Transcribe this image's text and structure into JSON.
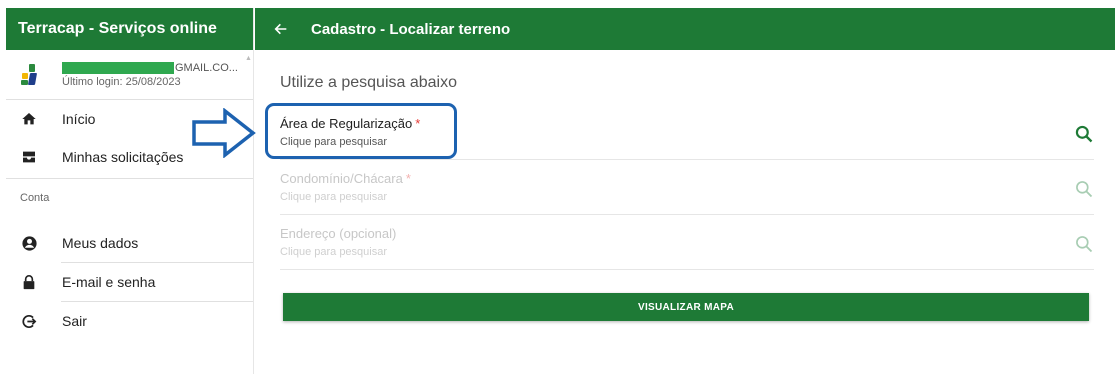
{
  "sidebar": {
    "title": "Terracap - Serviços online",
    "profile": {
      "email_suffix": "GMAIL.CO...",
      "last_login": "Último login: 25/08/2023"
    },
    "items": [
      {
        "label": "Início",
        "icon": "home-icon"
      },
      {
        "label": "Minhas solicitações",
        "icon": "inbox-icon"
      }
    ],
    "section_label": "Conta",
    "account_items": [
      {
        "label": "Meus dados",
        "icon": "account-circle-icon"
      },
      {
        "label": "E-mail e senha",
        "icon": "lock-icon"
      },
      {
        "label": "Sair",
        "icon": "logout-icon"
      }
    ]
  },
  "header": {
    "title": "Cadastro - Localizar terreno"
  },
  "main": {
    "intro": "Utilize a pesquisa abaixo",
    "fields": [
      {
        "label": "Área de Regularização",
        "required_mark": "*",
        "hint": "Clique para pesquisar",
        "state": "active"
      },
      {
        "label": "Condomínio/Chácara",
        "required_mark": "*",
        "hint": "Clique para pesquisar",
        "state": "disabled"
      },
      {
        "label": "Endereço (opcional)",
        "hint": "Clique para pesquisar",
        "state": "disabled"
      }
    ],
    "map_button": "VISUALIZAR MAPA"
  },
  "colors": {
    "primary_green": "#1e7a36",
    "required_red": "#e53935",
    "annotation_blue": "#1d62b0"
  }
}
